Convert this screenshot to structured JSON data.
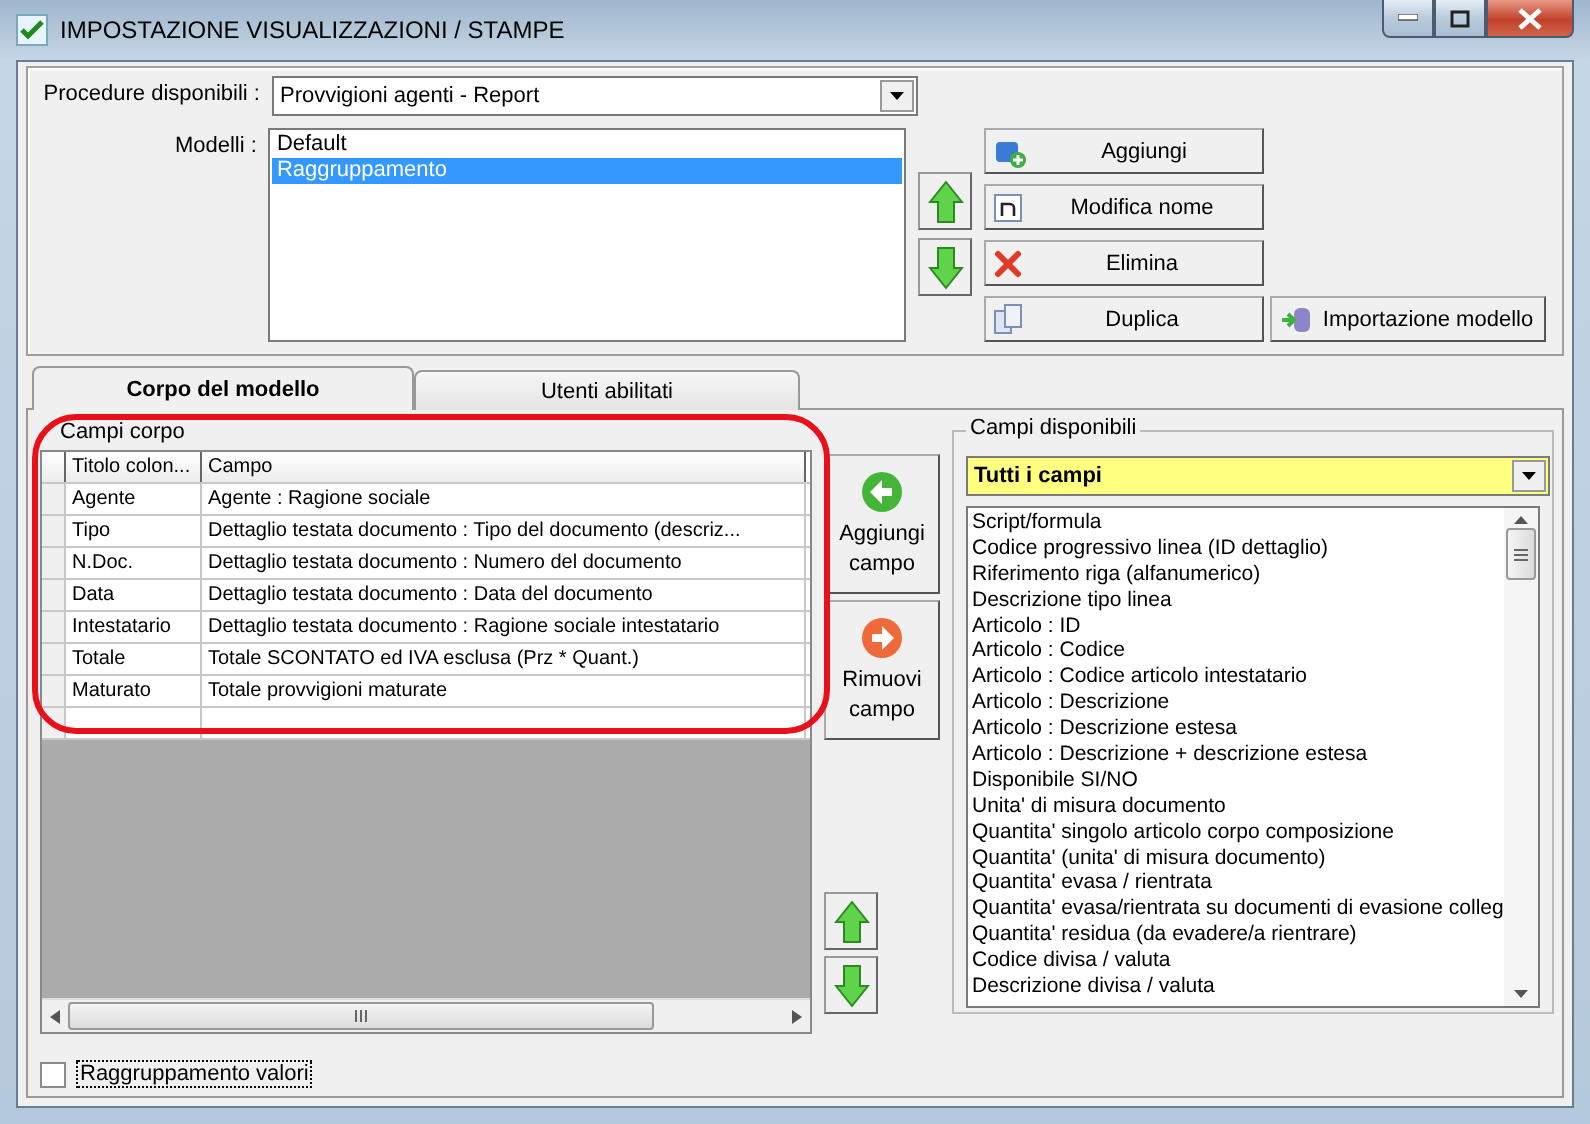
{
  "window": {
    "title": "IMPOSTAZIONE VISUALIZZAZIONI / STAMPE"
  },
  "procedure": {
    "label": "Procedure disponibili :",
    "value": "Provvigioni agenti - Report"
  },
  "models": {
    "label": "Modelli :",
    "items": [
      {
        "name": "Default",
        "selected": false
      },
      {
        "name": "Raggruppamento",
        "selected": true
      }
    ]
  },
  "model_buttons": [
    {
      "label": "Aggiungi",
      "kind": "add"
    },
    {
      "label": "Modifica nome",
      "kind": "rename"
    },
    {
      "label": "Elimina",
      "kind": "delete"
    },
    {
      "label": "Duplica",
      "kind": "duplicate"
    },
    {
      "label": "Importazione modello",
      "kind": "import"
    }
  ],
  "tabs": [
    {
      "label": "Corpo del modello",
      "selected": true
    },
    {
      "label": "Utenti abilitati",
      "selected": false
    }
  ],
  "body_fields": {
    "label": "Campi corpo",
    "columns": [
      "Titolo colon...",
      "Campo"
    ],
    "rows": [
      {
        "title": "Agente",
        "field": "Agente : Ragione sociale"
      },
      {
        "title": "Tipo",
        "field": "Dettaglio testata documento : Tipo del documento (descriz..."
      },
      {
        "title": "N.Doc.",
        "field": "Dettaglio testata documento : Numero del documento"
      },
      {
        "title": "Data",
        "field": "Dettaglio testata documento : Data del documento"
      },
      {
        "title": "Intestatario",
        "field": "Dettaglio testata documento : Ragione sociale intestatario"
      },
      {
        "title": "Totale",
        "field": "Totale SCONTATO ed IVA esclusa (Prz * Quant.)"
      },
      {
        "title": "Maturato",
        "field": "Totale provvigioni maturate"
      }
    ]
  },
  "field_buttons": [
    {
      "label": "Aggiungi campo",
      "kind": "add"
    },
    {
      "label": "Rimuovi campo",
      "kind": "remove"
    }
  ],
  "available": {
    "label": "Campi disponibili",
    "filter": "Tutti i campi",
    "items": [
      "Script/formula",
      "Codice progressivo linea (ID dettaglio)",
      "Riferimento riga (alfanumerico)",
      "Descrizione tipo linea",
      "Articolo : ID",
      "Articolo : Codice",
      "Articolo : Codice articolo intestatario",
      "Articolo : Descrizione",
      "Articolo : Descrizione estesa",
      "Articolo : Descrizione + descrizione estesa",
      "Disponibile SI/NO",
      "Unita' di misura documento",
      "Quantita' singolo articolo corpo composizione",
      "Quantita' (unita' di misura documento)",
      "Quantita' evasa / rientrata",
      "Quantita' evasa/rientrata su documenti di evasione colleg",
      "Quantita' residua (da evadere/a rientrare)",
      "Codice divisa / valuta",
      "Descrizione divisa / valuta"
    ]
  },
  "grouping": {
    "label": "Raggruppamento valori",
    "checked": false
  }
}
